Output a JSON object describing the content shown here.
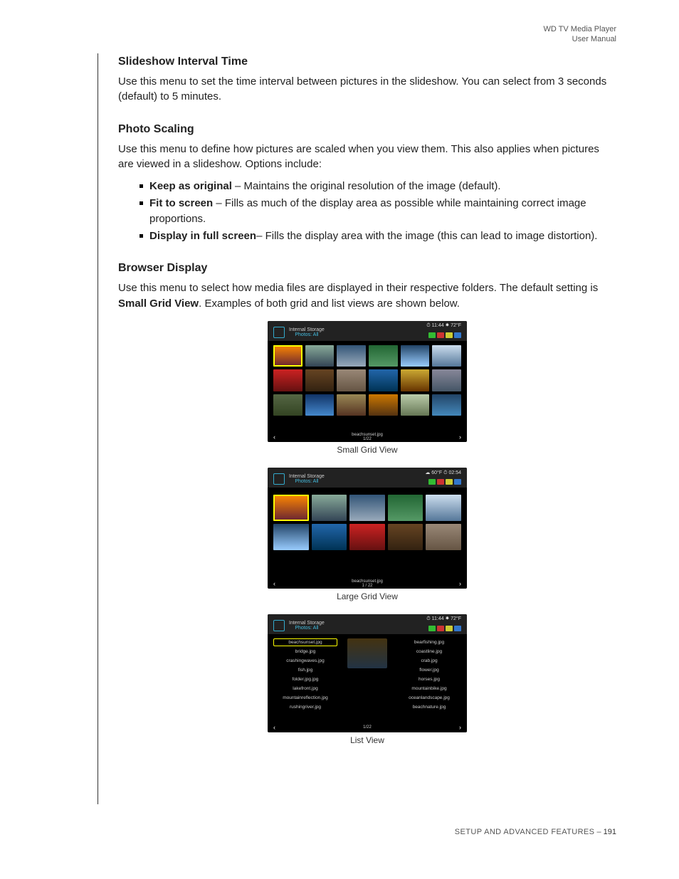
{
  "header": {
    "line1": "WD TV Media Player",
    "line2": "User Manual"
  },
  "s1": {
    "title": "Slideshow Interval Time",
    "text": "Use this menu to set the time interval between pictures in the slideshow. You can select from 3 seconds (default) to 5 minutes."
  },
  "s2": {
    "title": "Photo Scaling",
    "intro": "Use this menu to define how pictures are scaled when you view them. This also applies when pictures are viewed in a slideshow. Options include:",
    "items": [
      {
        "bold": "Keep as original",
        "text": " – Maintains the original resolution of the image (default)."
      },
      {
        "bold": "Fit to screen",
        "text": " – Fills as much of the display area as possible while maintaining correct image proportions."
      },
      {
        "bold": "Display in full screen",
        "text": "– Fills the display area with the image (this can lead to image distortion)."
      }
    ]
  },
  "s3": {
    "title": "Browser Display",
    "intro_a": "Use this menu to select how media files are displayed in their respective folders. The default setting is ",
    "intro_bold": "Small Grid View",
    "intro_b": ". Examples of both grid and list views are shown below."
  },
  "tv": {
    "storage": "Internal Storage",
    "filter": "Photos: All",
    "status1": "⏱ 11:44   ☀ 72°F",
    "status2": "☁ 60°F   ⏱ 02:54",
    "status3": "⏱ 11:44   ☀ 72°F",
    "foot1": "beachsunset.jpg",
    "foot1b": "1/22",
    "foot2": "beachsunset.jpg",
    "foot2b": "1 / 22",
    "foot3": "1/22"
  },
  "captions": {
    "c1": "Small Grid View",
    "c2": "Large Grid View",
    "c3": "List View"
  },
  "list": {
    "col1": [
      "beachsunset.jpg",
      "bridge.jpg",
      "crashingwaves.jpg",
      "fish.jpg",
      "folder.jpg.jpg",
      "lakefront.jpg",
      "mountainreflection.jpg",
      "rushingriver.jpg"
    ],
    "col2": [
      "bearfishing.jpg",
      "coastline.jpg",
      "crab.jpg",
      "flower.jpg",
      "horses.jpg",
      "mountainbike.jpg",
      "oceanlandscape.jpg",
      "beachnature.jpg"
    ]
  },
  "footer": {
    "section": "SETUP AND ADVANCED FEATURES",
    "sep": " – ",
    "page": "191"
  }
}
